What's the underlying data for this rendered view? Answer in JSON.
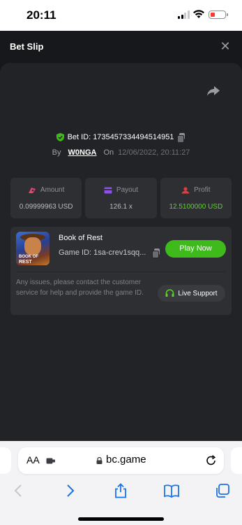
{
  "status_bar": {
    "time": "20:11",
    "battery_color": "#ff3b30"
  },
  "header": {
    "title": "Bet Slip",
    "close_icon": "close-icon"
  },
  "bet": {
    "id_label": "Bet ID:",
    "id_value": "1735457334494514951",
    "by_label": "By",
    "user": "W0NGA",
    "on_label": "On",
    "date": "12/06/2022, 20:11:27"
  },
  "stats": [
    {
      "label": "Amount",
      "value": "0.09999963 USD",
      "icon": "amount-icon",
      "icon_color": "#e8466e"
    },
    {
      "label": "Payout",
      "value": "126.1 x",
      "icon": "payout-icon",
      "icon_color": "#8f4cf2"
    },
    {
      "label": "Profit",
      "value": "12.5100000 USD",
      "icon": "profit-icon",
      "icon_color": "#e23b3b"
    }
  ],
  "game": {
    "name": "Book of Rest",
    "id_label": "Game ID:",
    "id_value": "1sa-crev1sqq...",
    "thumb_logo_line1": "BOOK OF",
    "thumb_logo_line2": "REST",
    "play_label": "Play Now",
    "issue_text": "Any issues, please contact the customer service for help and provide the game ID.",
    "support_label": "Live Support"
  },
  "colors": {
    "accent_green": "#3fba1b",
    "profit_green": "#5fd02c",
    "background": "#17181b",
    "panel": "#222326",
    "card": "#2e2f33"
  },
  "browser": {
    "aa_label": "AA",
    "url": "bc.game"
  }
}
